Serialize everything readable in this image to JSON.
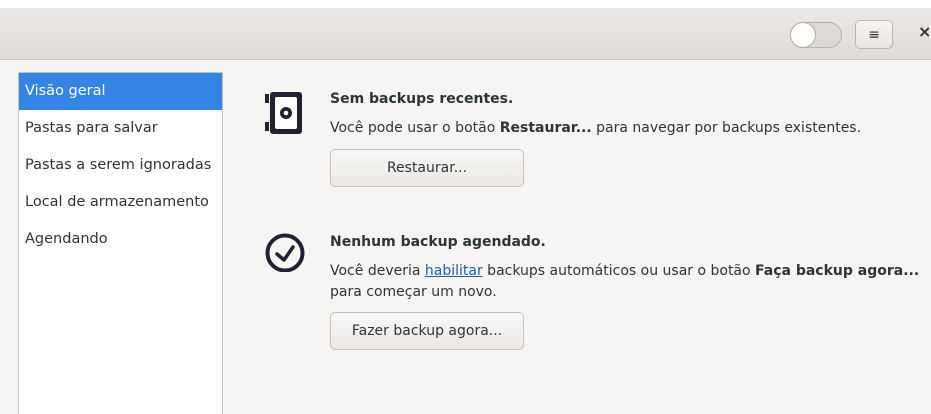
{
  "header": {
    "toggle": {
      "state": "off"
    },
    "menu_icon": "hamburger-menu-icon",
    "menu_glyph": "≡",
    "close_icon": "close-icon",
    "close_glyph": "×"
  },
  "sidebar": {
    "items": [
      {
        "label": "Visão geral",
        "active": true
      },
      {
        "label": "Pastas para salvar",
        "active": false
      },
      {
        "label": "Pastas a serem ignoradas",
        "active": false
      },
      {
        "label": "Local de armazenamento",
        "active": false
      },
      {
        "label": "Agendando",
        "active": false
      }
    ]
  },
  "main": {
    "backups": {
      "icon": "safe-icon",
      "title": "Sem backups recentes.",
      "text_pre": "Você pode usar o botão ",
      "text_bold": "Restaurar...",
      "text_post": " para navegar por backups existentes.",
      "button_label": "Restaurar..."
    },
    "schedule": {
      "icon": "clock-icon",
      "title": "Nenhum backup agendado.",
      "text_pre": "Você deveria ",
      "link_label": "habilitar",
      "text_mid": " backups automáticos ou usar o botão ",
      "text_bold": "Faça backup agora...",
      "text_post": " para começar um novo.",
      "button_label": "Fazer backup agora..."
    }
  },
  "colors": {
    "accent": "#3584e4",
    "link": "#1a5fb4",
    "window_bg": "#f6f5f4"
  }
}
